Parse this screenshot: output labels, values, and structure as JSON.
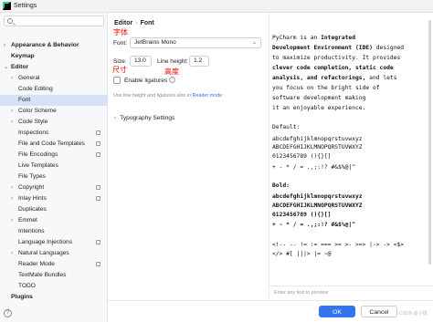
{
  "window": {
    "title": "Settings"
  },
  "sidebar": {
    "items": [
      {
        "label": "Appearance & Behavior",
        "arrow": "›",
        "bold": true
      },
      {
        "label": "Keymap",
        "arrow": "",
        "bold": true
      },
      {
        "label": "Editor",
        "arrow": "⌄",
        "bold": true
      },
      {
        "label": "General",
        "arrow": "›"
      },
      {
        "label": "Code Editing",
        "arrow": ""
      },
      {
        "label": "Font",
        "arrow": "",
        "selected": true
      },
      {
        "label": "Color Scheme",
        "arrow": "›"
      },
      {
        "label": "Code Style",
        "arrow": "›"
      },
      {
        "label": "Inspections",
        "arrow": "",
        "gear": true
      },
      {
        "label": "File and Code Templates",
        "arrow": "",
        "gear": true
      },
      {
        "label": "File Encodings",
        "arrow": "",
        "gear": true
      },
      {
        "label": "Live Templates",
        "arrow": ""
      },
      {
        "label": "File Types",
        "arrow": ""
      },
      {
        "label": "Copyright",
        "arrow": "›",
        "gear": true
      },
      {
        "label": "Inlay Hints",
        "arrow": "›",
        "gear": true
      },
      {
        "label": "Duplicates",
        "arrow": ""
      },
      {
        "label": "Emmet",
        "arrow": "›"
      },
      {
        "label": "Intentions",
        "arrow": ""
      },
      {
        "label": "Language Injections",
        "arrow": "",
        "gear": true
      },
      {
        "label": "Natural Languages",
        "arrow": "›"
      },
      {
        "label": "Reader Mode",
        "arrow": "",
        "gear": true
      },
      {
        "label": "TextMate Bundles",
        "arrow": ""
      },
      {
        "label": "TODO",
        "arrow": ""
      },
      {
        "label": "Plugins",
        "arrow": "",
        "bold": true
      }
    ]
  },
  "breadcrumb": {
    "parent": "Editor",
    "separator": "›",
    "current": "Font"
  },
  "font": {
    "label": "Font:",
    "value": "JetBrains Mono"
  },
  "size": {
    "label": "Size:",
    "value": "13.0"
  },
  "line_height": {
    "label": "Line height:",
    "value": "1.2"
  },
  "annotations": {
    "font_cn": "字体",
    "size_cn": "尺寸",
    "line_height_cn": "高度"
  },
  "ligatures": {
    "label": "Enable ligatures",
    "help": "?"
  },
  "hint": {
    "text": "Use line height and ligatures also in",
    "link": "Reader mode"
  },
  "typography": {
    "label": "Typography Settings",
    "arrow": "›"
  },
  "preview": {
    "intro": [
      [
        "PyCharm is an ",
        "Integrated"
      ],
      [
        "Development Environment (IDE)",
        " designed"
      ],
      [
        "to maximize productivity. It provides",
        ""
      ],
      [
        "clever code completion, static code",
        ""
      ],
      [
        "analysis, and refactorings,",
        " and lets"
      ],
      [
        "you focus on the bright side of",
        ""
      ],
      [
        "software development making",
        ""
      ],
      [
        "it an enjoyable experience.",
        ""
      ]
    ],
    "default_label": "Default:",
    "default_lines": [
      "abcdefghijklmnopqrstuvwxyz",
      "ABCDEFGHIJKLMNOPQRSTUVWXYZ",
      "0123456789 (){}[]",
      "+ - * / = .,;:!? #&$%@|^"
    ],
    "bold_label": "Bold:",
    "bold_lines": [
      "abcdefghijklmnopqrstuvwxyz",
      "ABCDEFGHIJKLMNOPQRSTUVWXYZ",
      "0123456789 (){}[]",
      "+ - * / = .,;:!? #&$%@|^"
    ],
    "ligature_lines": [
      "<!-- -- != := === >= >- >=> |-> -> <$>",
      "</> #[ |||> |= ~@"
    ],
    "placeholder": "Enter any text to preview"
  },
  "footer": {
    "ok": "OK",
    "cancel": "Cancel",
    "watermark": "CSDN @小猿"
  },
  "colors": {
    "accent": "#3574f0",
    "selection": "#d5e1f5",
    "annotation": "#ff0000"
  }
}
